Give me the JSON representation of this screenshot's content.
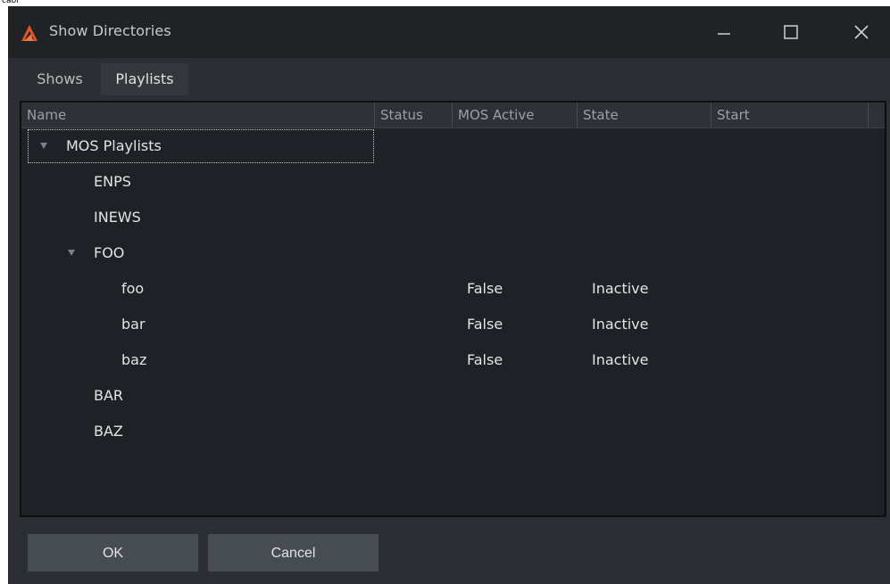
{
  "top_caption": "cabi",
  "window": {
    "title": "Show Directories",
    "minimize_glyph": "—",
    "maximize_glyph": "☐",
    "close_glyph": "✕"
  },
  "tabs": [
    {
      "label": "Shows",
      "active": false
    },
    {
      "label": "Playlists",
      "active": true
    }
  ],
  "columns": [
    "Name",
    "Status",
    "MOS Active",
    "State",
    "Start"
  ],
  "rows": [
    {
      "name": "MOS Playlists",
      "mos_active": "",
      "state": "",
      "expanded": true
    },
    {
      "name": "ENPS",
      "mos_active": "",
      "state": ""
    },
    {
      "name": "INEWS",
      "mos_active": "",
      "state": ""
    },
    {
      "name": "FOO",
      "mos_active": "",
      "state": "",
      "expanded": true
    },
    {
      "name": "foo",
      "mos_active": "False",
      "state": "Inactive"
    },
    {
      "name": "bar",
      "mos_active": "False",
      "state": "Inactive"
    },
    {
      "name": "baz",
      "mos_active": "False",
      "state": "Inactive"
    },
    {
      "name": "BAR",
      "mos_active": "",
      "state": ""
    },
    {
      "name": "BAZ",
      "mos_active": "",
      "state": ""
    }
  ],
  "buttons": {
    "ok": "OK",
    "cancel": "Cancel"
  },
  "colors": {
    "accent": "#e0532b",
    "background": "#2b2f33",
    "titlebar": "#202326",
    "panel": "#1e2125"
  }
}
